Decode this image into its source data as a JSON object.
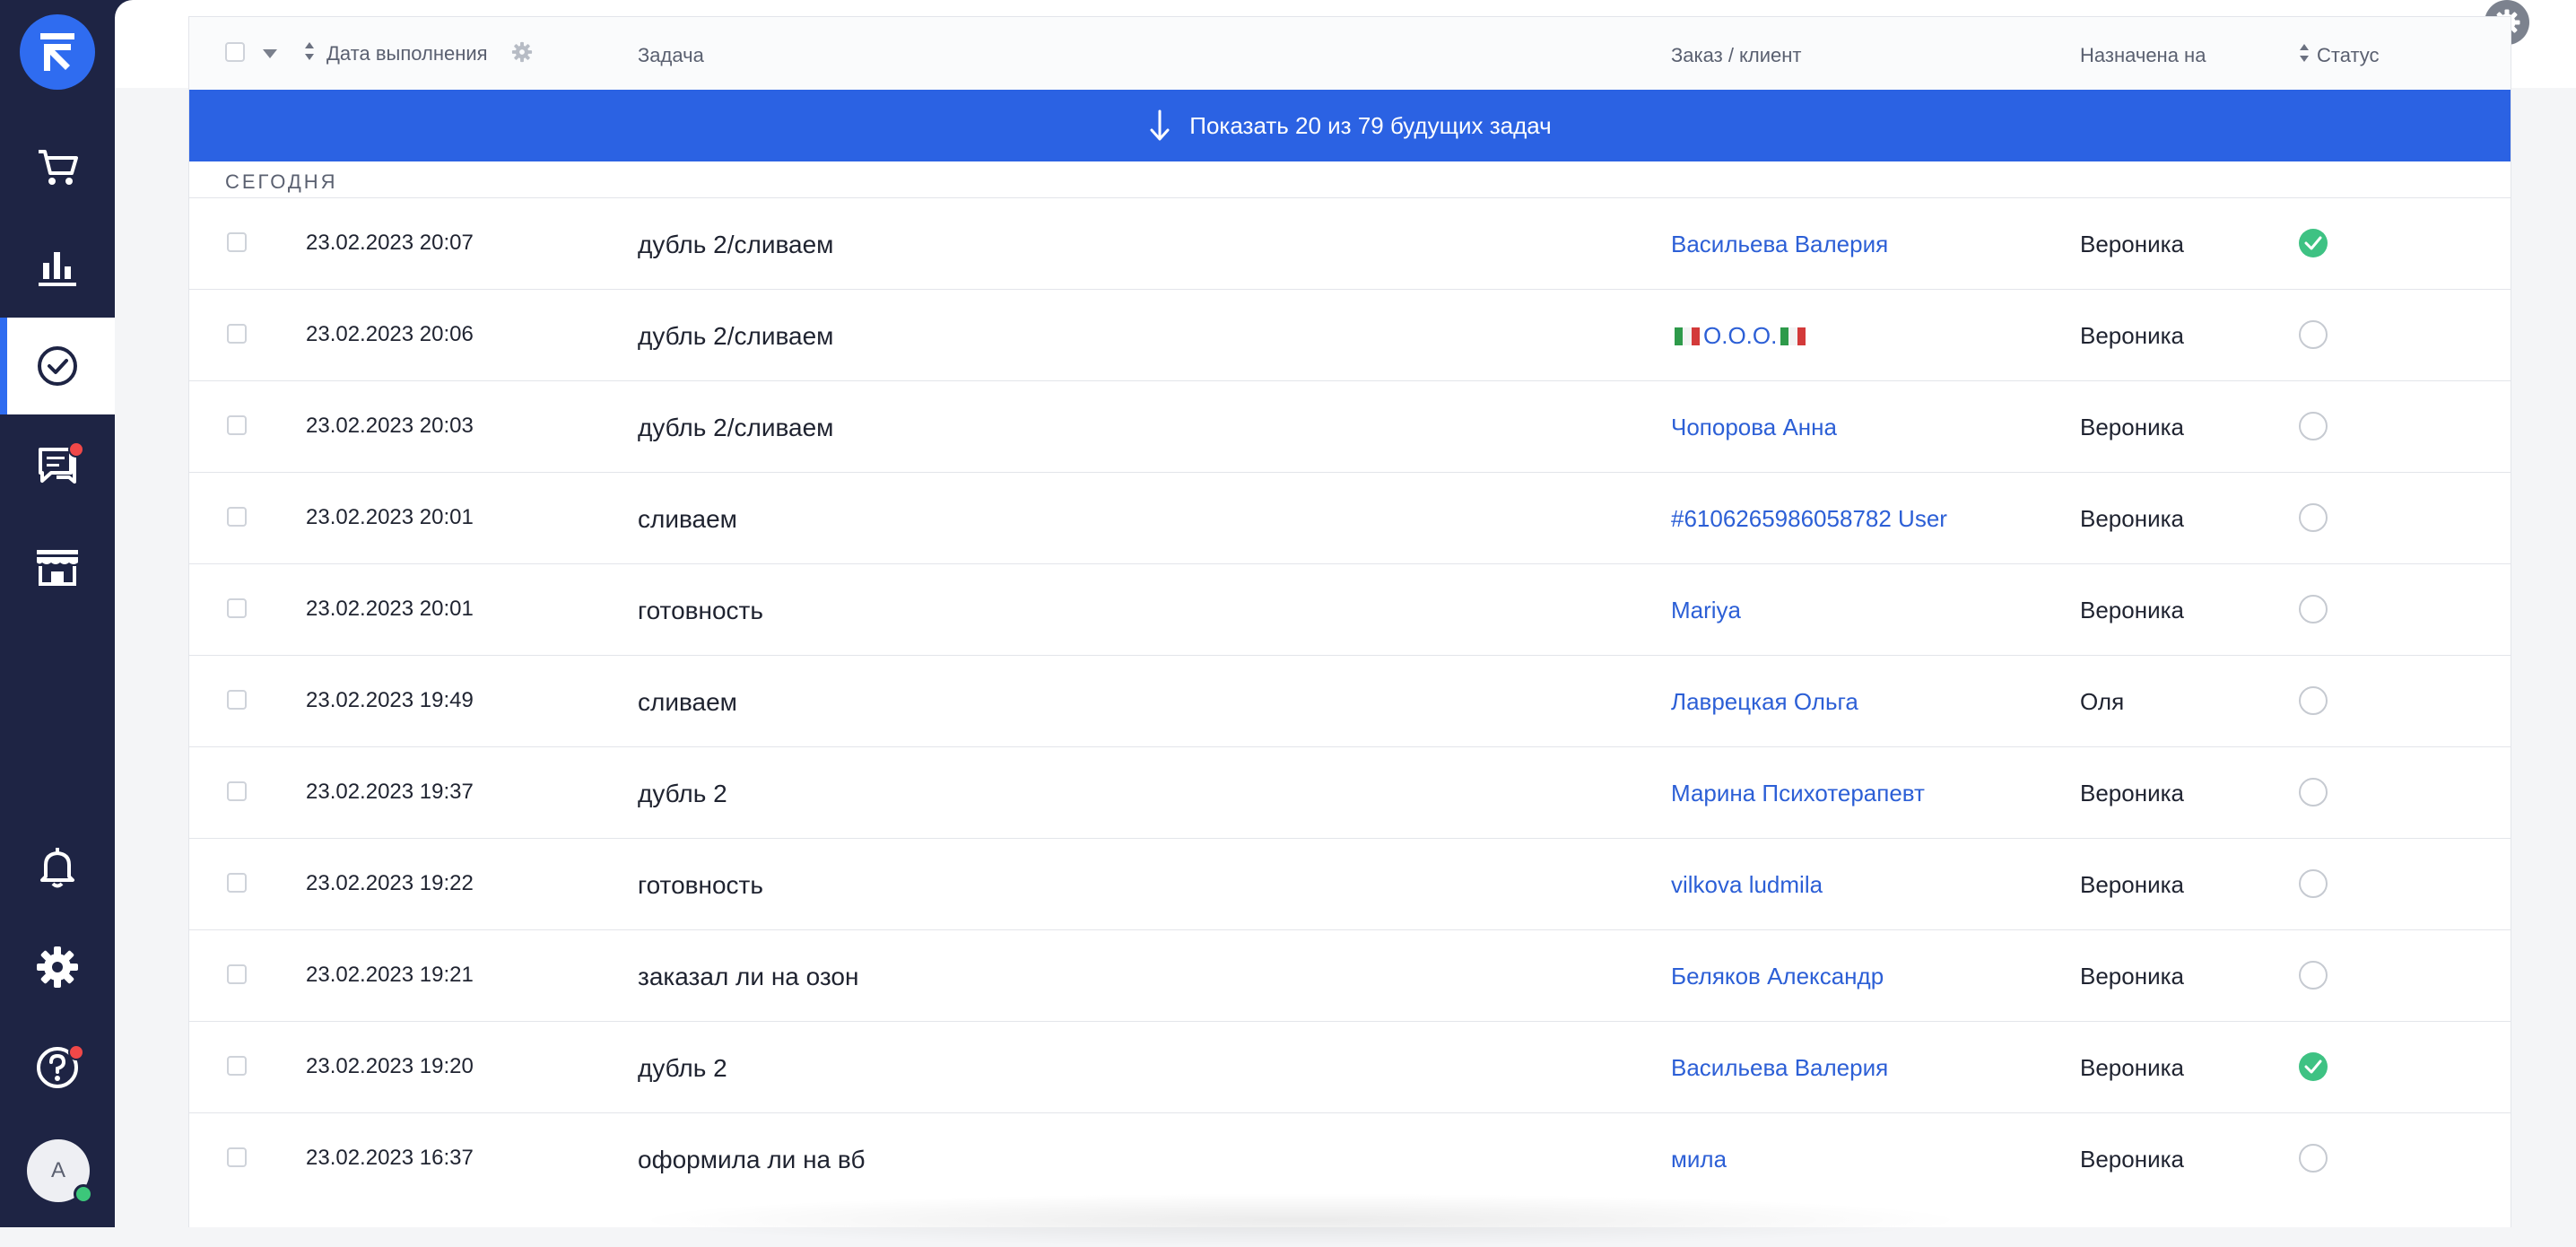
{
  "sidebar": {
    "avatar_initial": "A",
    "items": [
      {
        "name": "cart-icon"
      },
      {
        "name": "analytics-icon"
      },
      {
        "name": "tasks-icon",
        "active": true
      },
      {
        "name": "chat-icon",
        "badge": true
      },
      {
        "name": "store-icon"
      },
      {
        "name": "bell-icon"
      },
      {
        "name": "gear-icon"
      },
      {
        "name": "help-icon",
        "badge": true
      }
    ]
  },
  "table": {
    "headers": {
      "date": "Дата выполнения",
      "task": "Задача",
      "client": "Заказ / клиент",
      "assignee": "Назначена на",
      "status": "Статус"
    },
    "banner": "Показать 20 из 79 будущих задач",
    "section": "СЕГОДНЯ",
    "rows": [
      {
        "date": "23.02.2023 20:07",
        "task": "дубль 2/сливаем",
        "client": "Васильева Валерия",
        "assignee": "Вероника",
        "done": true
      },
      {
        "date": "23.02.2023 20:06",
        "task": "дубль 2/сливаем",
        "client": "О.О.О.",
        "assignee": "Вероника",
        "done": false
      },
      {
        "date": "23.02.2023 20:03",
        "task": "дубль 2/сливаем",
        "client": "Чопорова Анна",
        "assignee": "Вероника",
        "done": false
      },
      {
        "date": "23.02.2023 20:01",
        "task": "сливаем",
        "client": "#6106265986058782 User",
        "assignee": "Вероника",
        "done": false
      },
      {
        "date": "23.02.2023 20:01",
        "task": "готовность",
        "client": "Mariya",
        "assignee": "Вероника",
        "done": false
      },
      {
        "date": "23.02.2023 19:49",
        "task": "сливаем",
        "client": "Лаврецкая Ольга",
        "assignee": "Оля",
        "done": false
      },
      {
        "date": "23.02.2023 19:37",
        "task": "дубль 2",
        "client": "Марина Психотерапевт",
        "assignee": "Вероника",
        "done": false
      },
      {
        "date": "23.02.2023 19:22",
        "task": "готовность",
        "client": "vilkova ludmila",
        "assignee": "Вероника",
        "done": false
      },
      {
        "date": "23.02.2023 19:21",
        "task": "заказал ли на озон",
        "client": "Беляков Александр",
        "assignee": "Вероника",
        "done": false
      },
      {
        "date": "23.02.2023 19:20",
        "task": "дубль 2",
        "client": "Васильева Валерия",
        "assignee": "Вероника",
        "done": true
      },
      {
        "date": "23.02.2023 16:37",
        "task": "оформила ли на вб",
        "client": "мила",
        "assignee": "Вероника",
        "done": false
      }
    ]
  }
}
